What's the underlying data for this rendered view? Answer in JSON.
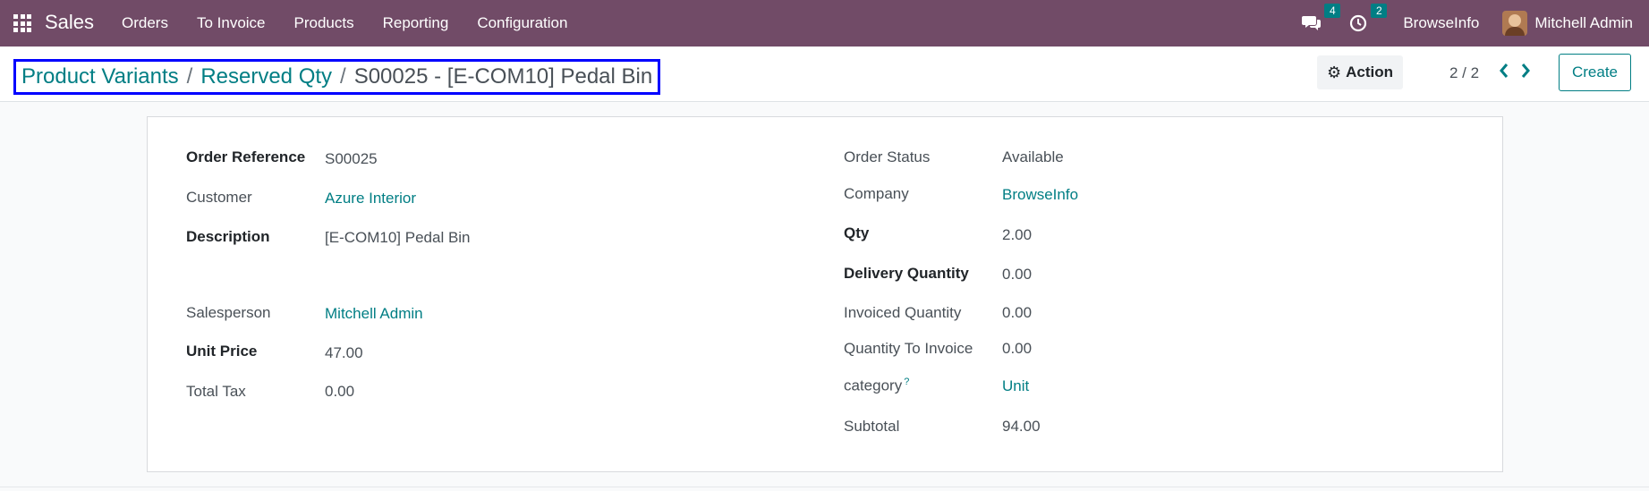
{
  "navbar": {
    "app_name": "Sales",
    "menu": [
      "Orders",
      "To Invoice",
      "Products",
      "Reporting",
      "Configuration"
    ],
    "messages_count": "4",
    "activities_count": "2",
    "company": "BrowseInfo",
    "user": "Mitchell Admin",
    "bg_color": "#714b67"
  },
  "breadcrumb": {
    "items": [
      "Product Variants",
      "Reserved Qty"
    ],
    "separator": "/",
    "current": "S00025 - [E-COM10] Pedal Bin"
  },
  "control": {
    "action_label": "Action",
    "pager": "2 / 2",
    "create_label": "Create"
  },
  "form": {
    "left": [
      {
        "label": "Order Reference",
        "value": "S00025"
      },
      {
        "label": "Customer",
        "value": "Azure Interior"
      },
      {
        "label": "Description",
        "value": "[E-COM10] Pedal Bin"
      },
      {
        "label": "Salesperson",
        "value": "Mitchell Admin"
      },
      {
        "label": "Unit Price",
        "value": "47.00"
      },
      {
        "label": "Total Tax",
        "value": "0.00"
      }
    ],
    "right": [
      {
        "label": "Order Status",
        "value": "Available"
      },
      {
        "label": "Company",
        "value": "BrowseInfo"
      },
      {
        "label": "Qty",
        "value": "2.00"
      },
      {
        "label": "Delivery Quantity",
        "value": "0.00"
      },
      {
        "label": "Invoiced Quantity",
        "value": "0.00"
      },
      {
        "label": "Quantity To Invoice",
        "value": "0.00"
      },
      {
        "label": "category",
        "value": "Unit",
        "help": "?"
      },
      {
        "label": "Subtotal",
        "value": "94.00"
      }
    ]
  },
  "colors": {
    "accent": "#017e84",
    "highlight_border": "#0000ff"
  }
}
